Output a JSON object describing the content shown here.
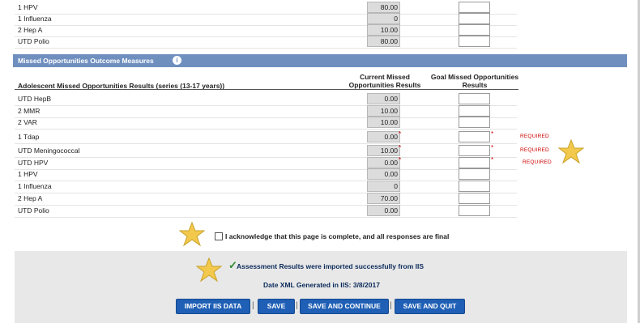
{
  "top_rows": [
    {
      "label": "1 HPV",
      "current": "80.00"
    },
    {
      "label": "1 Influenza",
      "current": "0"
    },
    {
      "label": "2 Hep A",
      "current": "10.00"
    },
    {
      "label": "UTD Polio",
      "current": "80.00"
    }
  ],
  "section": {
    "title": "Missed Opportunities Outcome Measures",
    "info_icon": "i"
  },
  "table_headers": {
    "results": "Adolescent Missed Opportunities Results (series (13-17 years))",
    "current_line1": "Current Missed",
    "current_line2": "Opportunities Results",
    "goal_line1": "Goal Missed Opportunities",
    "goal_line2": "Results"
  },
  "rows": [
    {
      "label": "UTD HepB",
      "current": "0.00",
      "required": ""
    },
    {
      "label": "2 MMR",
      "current": "10.00",
      "required": ""
    },
    {
      "label": "2 VAR",
      "current": "10.00",
      "required": ""
    },
    {
      "label": "1 Tdap",
      "current": "0.00",
      "required": "REQUIRED"
    },
    {
      "label": "UTD Meningococcal",
      "current": "10.00",
      "required": "REQUIRED"
    },
    {
      "label": "UTD HPV",
      "current": "0.00",
      "required": "REQUIRED"
    },
    {
      "label": "1 HPV",
      "current": "0.00",
      "required": ""
    },
    {
      "label": "1 Influenza",
      "current": "0",
      "required": ""
    },
    {
      "label": "2 Hep A",
      "current": "70.00",
      "required": ""
    },
    {
      "label": "UTD Polio",
      "current": "0.00",
      "required": ""
    }
  ],
  "required_asterisk": "*",
  "acknowledge": "I acknowledge that this page is complete, and all responses are final",
  "import_message": "Assessment Results were imported successfully from IIS",
  "date_message": "Date XML Generated in IIS: 3/8/2017",
  "buttons": {
    "import": "IMPORT IIS DATA",
    "save": "SAVE",
    "save_continue": "SAVE AND CONTINUE",
    "save_quit": "SAVE AND QUIT",
    "separator": "|"
  },
  "colors": {
    "section_bar": "#6f8fbf",
    "button": "#1f5fb5",
    "required": "#cc0000",
    "star": "#f2c94c"
  }
}
